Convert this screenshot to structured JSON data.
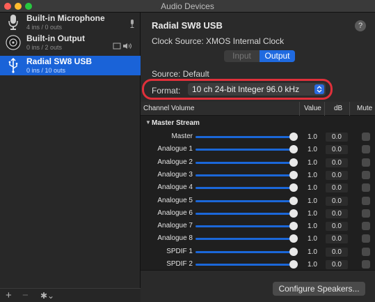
{
  "window": {
    "title": "Audio Devices"
  },
  "devices": [
    {
      "name": "Built-in Microphone",
      "io": "4 ins / 0 outs",
      "icon": "microphone-icon",
      "right_icon": "mic-small-icon",
      "selected": false
    },
    {
      "name": "Built-in Output",
      "io": "0 ins / 2 outs",
      "icon": "speaker-icon",
      "right_icon": "screen-speaker-icon",
      "selected": false
    },
    {
      "name": "Radial SW8 USB",
      "io": "0 ins / 10 outs",
      "icon": "usb-icon",
      "selected": true
    }
  ],
  "sidebar_bottom": {
    "add": "+",
    "remove": "−",
    "gear": "✱⌄"
  },
  "detail": {
    "device_title": "Radial SW8 USB",
    "help": "?",
    "clock_source": "Clock Source:  XMOS Internal Clock",
    "tabs": {
      "input": "Input",
      "output": "Output",
      "selected": "Output"
    },
    "source": "Source:  Default",
    "format_label": "Format:",
    "format_value": "10 ch 24-bit Integer 96.0 kHz"
  },
  "table": {
    "headers": {
      "channel_volume": "Channel Volume",
      "value": "Value",
      "db": "dB",
      "mute": "Mute"
    },
    "group": "Master Stream",
    "rows": [
      {
        "name": "Master",
        "value": "1.0",
        "db": "0.0",
        "level": 1.0,
        "muted": false
      },
      {
        "name": "Analogue 1",
        "value": "1.0",
        "db": "0.0",
        "level": 1.0,
        "muted": false
      },
      {
        "name": "Analogue 2",
        "value": "1.0",
        "db": "0.0",
        "level": 1.0,
        "muted": false
      },
      {
        "name": "Analogue 3",
        "value": "1.0",
        "db": "0.0",
        "level": 1.0,
        "muted": false
      },
      {
        "name": "Analogue 4",
        "value": "1.0",
        "db": "0.0",
        "level": 1.0,
        "muted": false
      },
      {
        "name": "Analogue 5",
        "value": "1.0",
        "db": "0.0",
        "level": 1.0,
        "muted": false
      },
      {
        "name": "Analogue 6",
        "value": "1.0",
        "db": "0.0",
        "level": 1.0,
        "muted": false
      },
      {
        "name": "Analogue 7",
        "value": "1.0",
        "db": "0.0",
        "level": 1.0,
        "muted": false
      },
      {
        "name": "Analogue 8",
        "value": "1.0",
        "db": "0.0",
        "level": 1.0,
        "muted": false
      },
      {
        "name": "SPDIF 1",
        "value": "1.0",
        "db": "0.0",
        "level": 1.0,
        "muted": false
      },
      {
        "name": "SPDIF 2",
        "value": "1.0",
        "db": "0.0",
        "level": 1.0,
        "muted": false
      }
    ]
  },
  "footer": {
    "configure_speakers": "Configure Speakers..."
  },
  "colors": {
    "accent": "#1f6ae0",
    "highlight_ring": "#e0303a",
    "selected_row": "#1a63d8"
  }
}
